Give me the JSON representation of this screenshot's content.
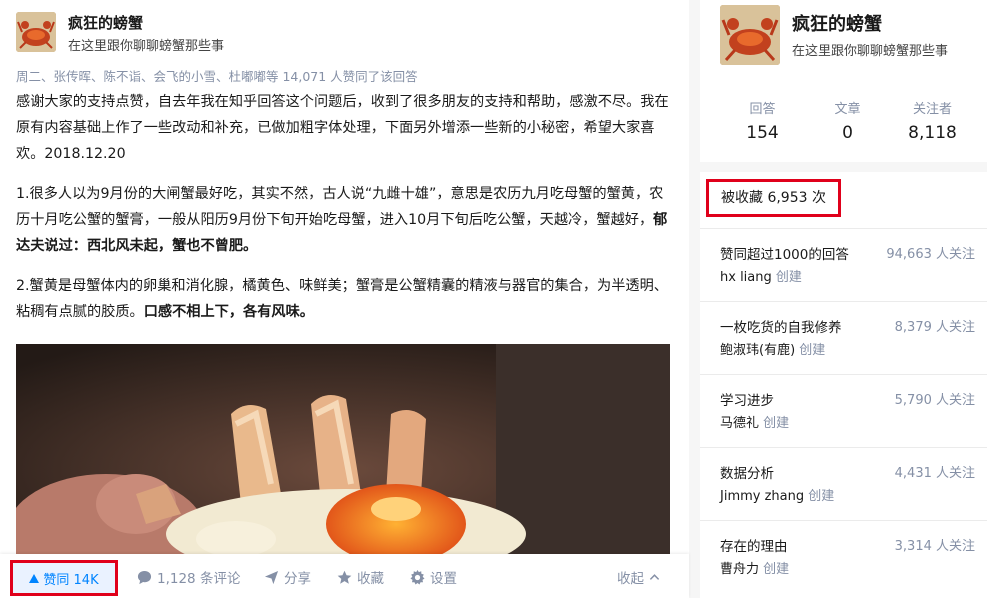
{
  "author": {
    "name": "疯狂的螃蟹",
    "bio": "在这里跟你聊聊螃蟹那些事"
  },
  "voters_text": "周二、张传晖、陈不诣、会飞的小雪、杜嘟嘟等 14,071 人赞同了该回答",
  "content": {
    "p1": "感谢大家的支持点赞，自去年我在知乎回答这个问题后，收到了很多朋友的支持和帮助，感激不尽。我在原有内容基础上作了一些改动和补充，已做加粗字体处理，下面另外增添一些新的小秘密，希望大家喜欢。2018.12.20",
    "p2_plain": "1.很多人以为9月份的大闸蟹最好吃，其实不然，古人说“九雌十雄”，意思是农历九月吃母蟹的蟹黄，农历十月吃公蟹的蟹膏，一般从阳历9月份下旬开始吃母蟹，进入10月下旬后吃公蟹，天越冷，蟹越好，",
    "p2_bold": "郁达夫说过：西北风未起，蟹也不曾肥。",
    "p3_plain": "2.蟹黄是母蟹体内的卵巢和消化腺，橘黄色、味鲜美；蟹膏是公蟹精囊的精液与器官的集合，为半透明、粘稠有点腻的胶质。",
    "p3_bold": "口感不相上下，各有风味。"
  },
  "actions": {
    "vote_label": "赞同 14K",
    "comments_label": "1,128 条评论",
    "share_label": "分享",
    "favorite_label": "收藏",
    "settings_label": "设置",
    "collapse_label": "收起"
  },
  "profile": {
    "name": "疯狂的螃蟹",
    "bio": "在这里跟你聊聊螃蟹那些事",
    "stats": [
      {
        "label": "回答",
        "value": "154"
      },
      {
        "label": "文章",
        "value": "0"
      },
      {
        "label": "关注者",
        "value": "8,118"
      }
    ]
  },
  "collections": {
    "title_prefix": "被收藏",
    "count": "6,953",
    "title_suffix": "次",
    "items": [
      {
        "name": "赞同超过1000的回答",
        "creator": "hx liang",
        "created": "创建",
        "follows": "94,663 人关注"
      },
      {
        "name": "一枚吃货的自我修养",
        "creator": "鲍淑玮(有鹿)",
        "created": "创建",
        "follows": "8,379 人关注"
      },
      {
        "name": "学习进步",
        "creator": "马德礼",
        "created": "创建",
        "follows": "5,790 人关注"
      },
      {
        "name": "数据分析",
        "creator": "Jimmy zhang",
        "created": "创建",
        "follows": "4,431 人关注"
      },
      {
        "name": "存在的理由",
        "creator": "曹舟力",
        "created": "创建",
        "follows": "3,314 人关注"
      }
    ]
  },
  "colors": {
    "highlight_border": "#e0001b",
    "vote_blue": "#0084ff",
    "muted_text": "#8590a6"
  },
  "icons": [
    "crab-avatar",
    "upvote-arrow-icon",
    "comment-icon",
    "share-icon",
    "star-icon",
    "gear-icon",
    "chevron-up-icon"
  ]
}
